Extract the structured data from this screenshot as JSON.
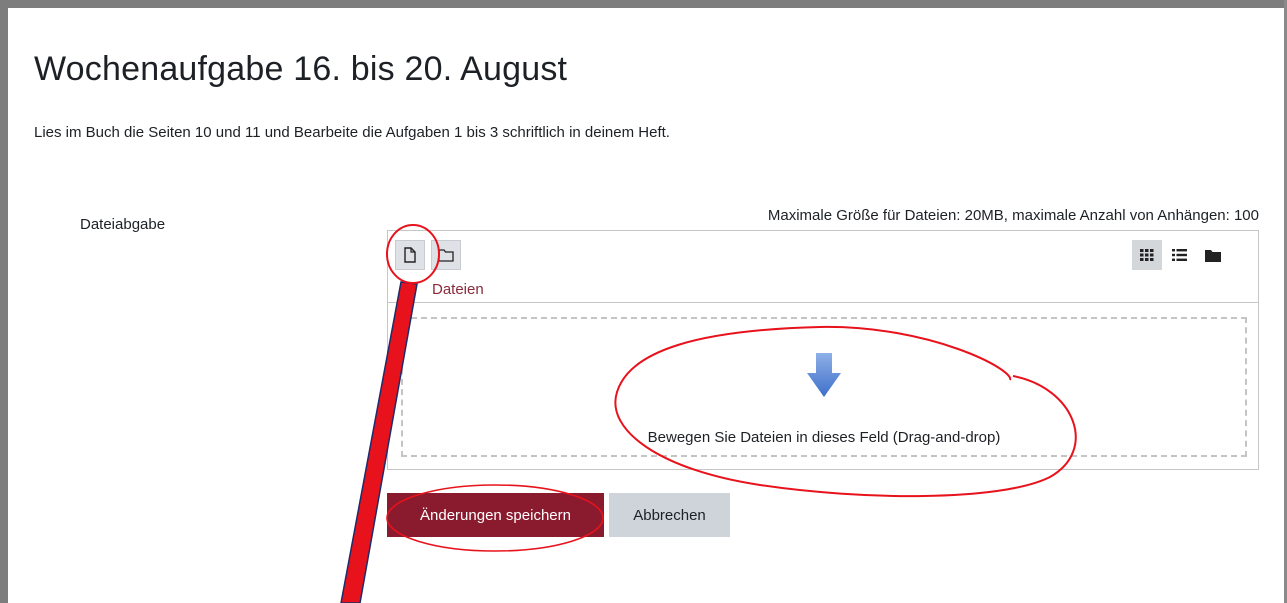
{
  "page": {
    "title": "Wochenaufgabe 16. bis 20. August",
    "description": "Lies im Buch die Seiten 10 und 11 und Bearbeite die Aufgaben 1 bis 3 schriftlich in deinem Heft."
  },
  "submission": {
    "field_label": "Dateiabgabe",
    "limits_text": "Maximale Größe für Dateien: 20MB, maximale Anzahl von Anhängen: 100"
  },
  "file_manager": {
    "toolbar": {
      "add_file_icon": "file-icon",
      "create_folder_icon": "folder-icon",
      "views": [
        {
          "icon": "grid-icon",
          "active": true
        },
        {
          "icon": "list-icon",
          "active": false
        },
        {
          "icon": "folder-tree-icon",
          "active": false
        }
      ]
    },
    "path_label": "Dateien",
    "dropzone_text": "Bewegen Sie Dateien in dieses Feld (Drag-and-drop)",
    "dropzone_icon": "arrow-down-icon"
  },
  "buttons": {
    "save_label": "Änderungen speichern",
    "cancel_label": "Abbrechen"
  },
  "colors": {
    "primary": "#8a1b2e",
    "secondary": "#ced4da",
    "annotation_red": "#e8121c",
    "link": "#8b2a3b"
  }
}
